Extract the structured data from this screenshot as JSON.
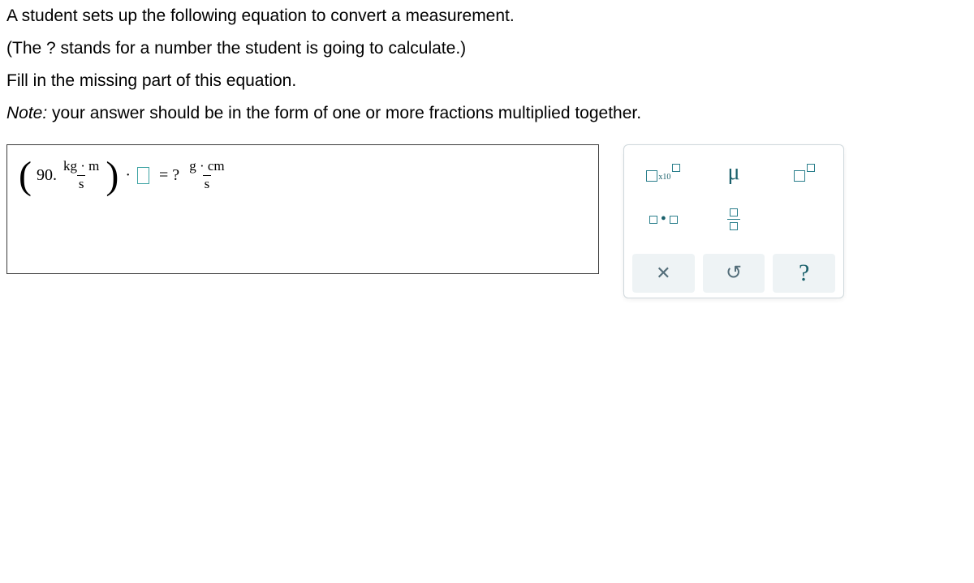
{
  "prompt": {
    "line1": "A student sets up the following equation to convert a measurement.",
    "line2": "(The ? stands for a number the student is going to calculate.)",
    "line3": "Fill in the missing part of this equation.",
    "note_label": "Note:",
    "note_text": " your answer should be in the form of one or more fractions multiplied together."
  },
  "equation": {
    "coefficient": "90.",
    "lhs_frac_num": "kg · m",
    "lhs_frac_den": "s",
    "equals": "= ?",
    "rhs_frac_num": "g · cm",
    "rhs_frac_den": "s"
  },
  "keypad": {
    "sci_label": "x10",
    "mu": "μ",
    "clear": "✕",
    "undo": "↻",
    "help": "?"
  }
}
